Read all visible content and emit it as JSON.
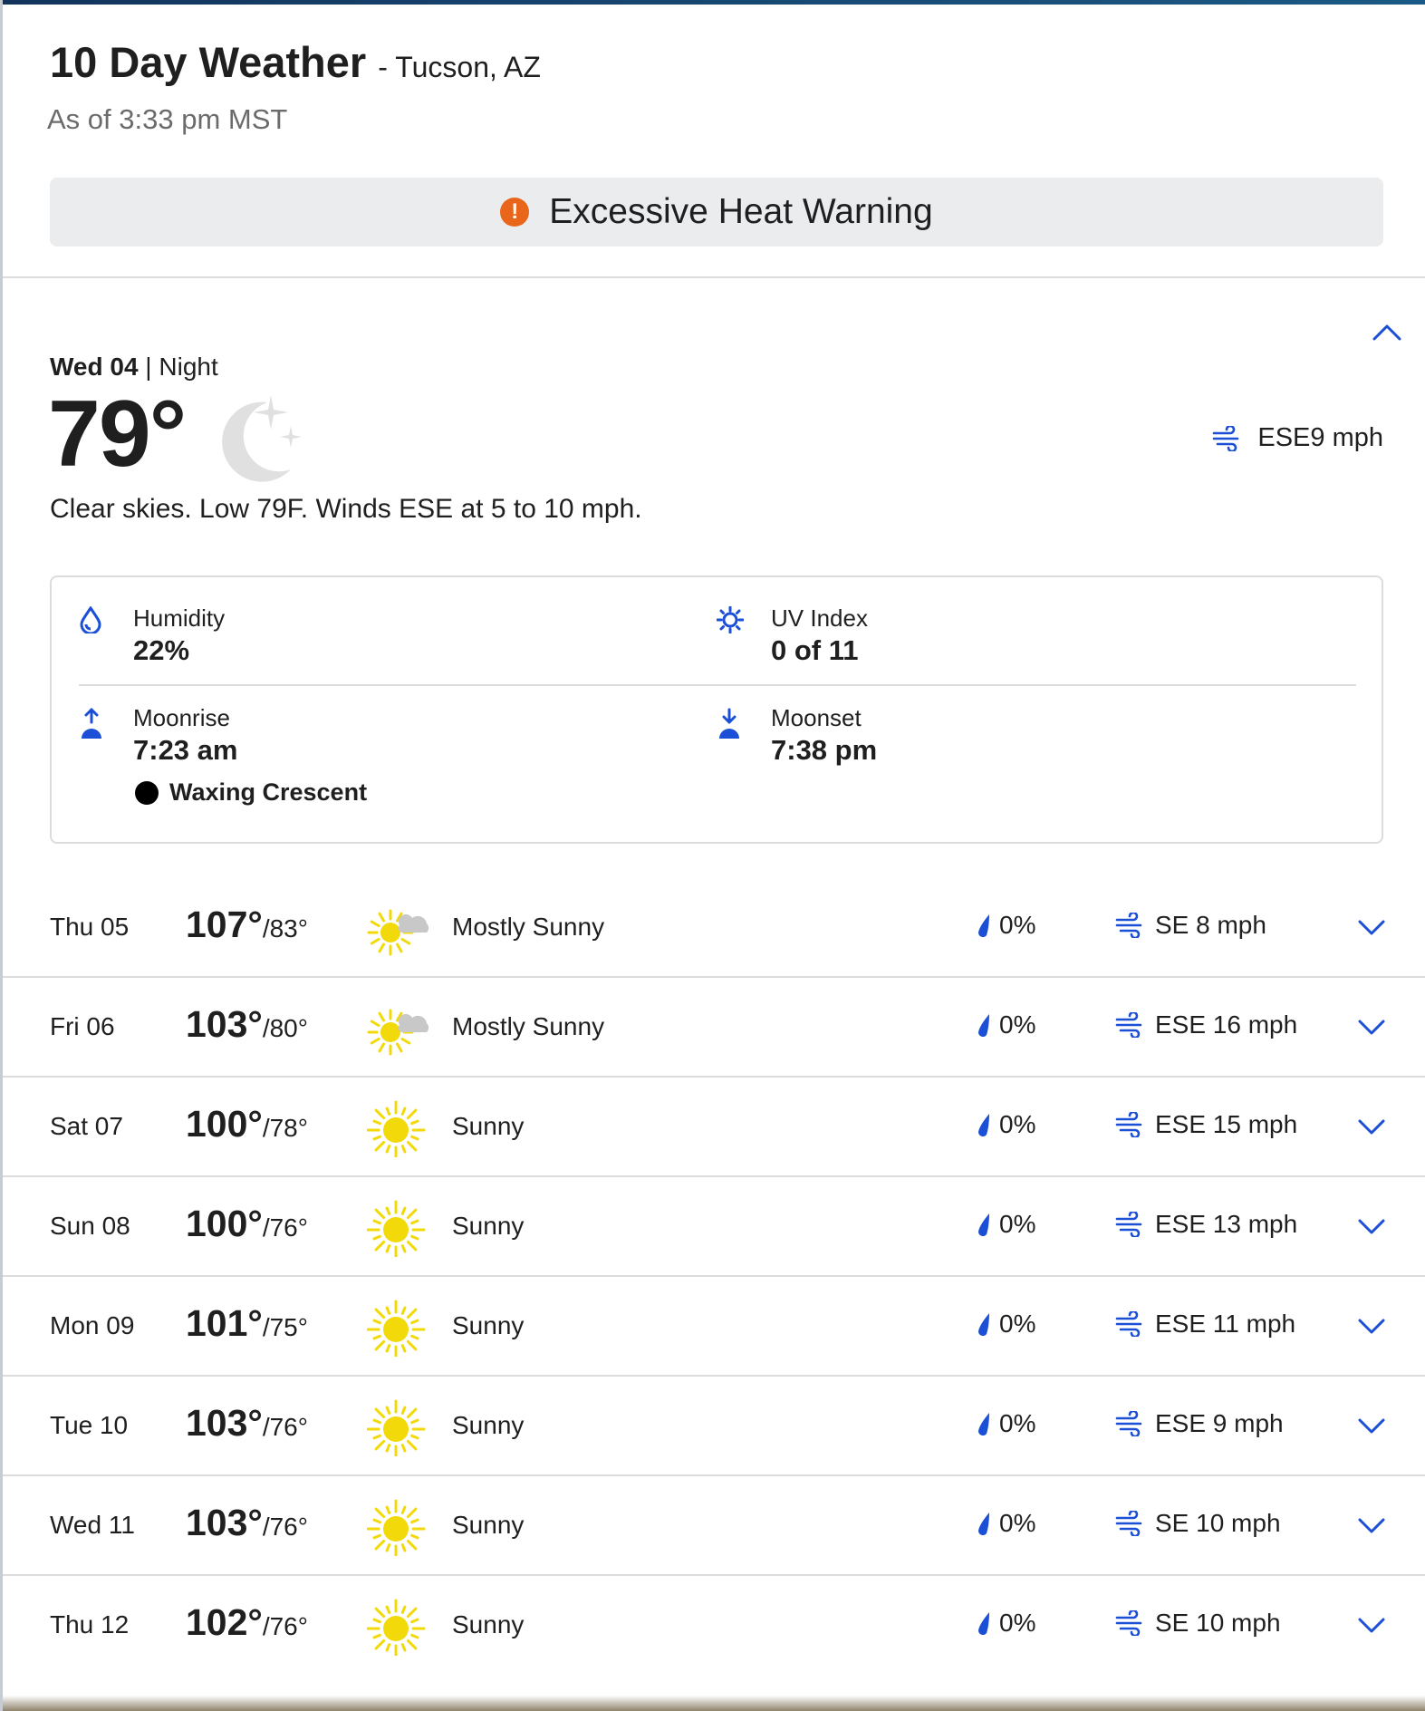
{
  "header": {
    "title": "10 Day Weather",
    "location": "- Tucson, AZ",
    "as_of": "As of 3:33 pm MST"
  },
  "alert": {
    "label": "Excessive Heat Warning",
    "icon": "exclamation-icon",
    "color": "#e8651a"
  },
  "current": {
    "day": "Wed 04",
    "separator": " | ",
    "period": "Night",
    "temp": "79°",
    "icon": "crescent-moon-stars-icon",
    "wind": "ESE9 mph",
    "narrative": "Clear skies. Low 79F. Winds ESE at 5 to 10 mph.",
    "details": {
      "humidity_label": "Humidity",
      "humidity": "22%",
      "uv_label": "UV Index",
      "uv": "0 of 11",
      "moonrise_label": "Moonrise",
      "moonrise": "7:23 am",
      "moonset_label": "Moonset",
      "moonset": "7:38 pm",
      "moon_phase": "Waxing Crescent"
    }
  },
  "forecast": [
    {
      "day": "Thu 05",
      "hi": "107°",
      "lo": "/83°",
      "icon": "mostly-sunny-icon",
      "cond": "Mostly Sunny",
      "precip": "0%",
      "wind": "SE 8 mph"
    },
    {
      "day": "Fri 06",
      "hi": "103°",
      "lo": "/80°",
      "icon": "mostly-sunny-icon",
      "cond": "Mostly Sunny",
      "precip": "0%",
      "wind": "ESE 16 mph"
    },
    {
      "day": "Sat 07",
      "hi": "100°",
      "lo": "/78°",
      "icon": "sunny-icon",
      "cond": "Sunny",
      "precip": "0%",
      "wind": "ESE 15 mph"
    },
    {
      "day": "Sun 08",
      "hi": "100°",
      "lo": "/76°",
      "icon": "sunny-icon",
      "cond": "Sunny",
      "precip": "0%",
      "wind": "ESE 13 mph"
    },
    {
      "day": "Mon 09",
      "hi": "101°",
      "lo": "/75°",
      "icon": "sunny-icon",
      "cond": "Sunny",
      "precip": "0%",
      "wind": "ESE 11 mph"
    },
    {
      "day": "Tue 10",
      "hi": "103°",
      "lo": "/76°",
      "icon": "sunny-icon",
      "cond": "Sunny",
      "precip": "0%",
      "wind": "ESE 9 mph"
    },
    {
      "day": "Wed 11",
      "hi": "103°",
      "lo": "/76°",
      "icon": "sunny-icon",
      "cond": "Sunny",
      "precip": "0%",
      "wind": "SE 10 mph"
    },
    {
      "day": "Thu 12",
      "hi": "102°",
      "lo": "/76°",
      "icon": "sunny-icon",
      "cond": "Sunny",
      "precip": "0%",
      "wind": "SE 10 mph"
    }
  ],
  "colors": {
    "accent": "#1a4fd6",
    "sun": "#f2d90a",
    "text": "#1f1f1f",
    "muted": "#6b6b6b"
  }
}
